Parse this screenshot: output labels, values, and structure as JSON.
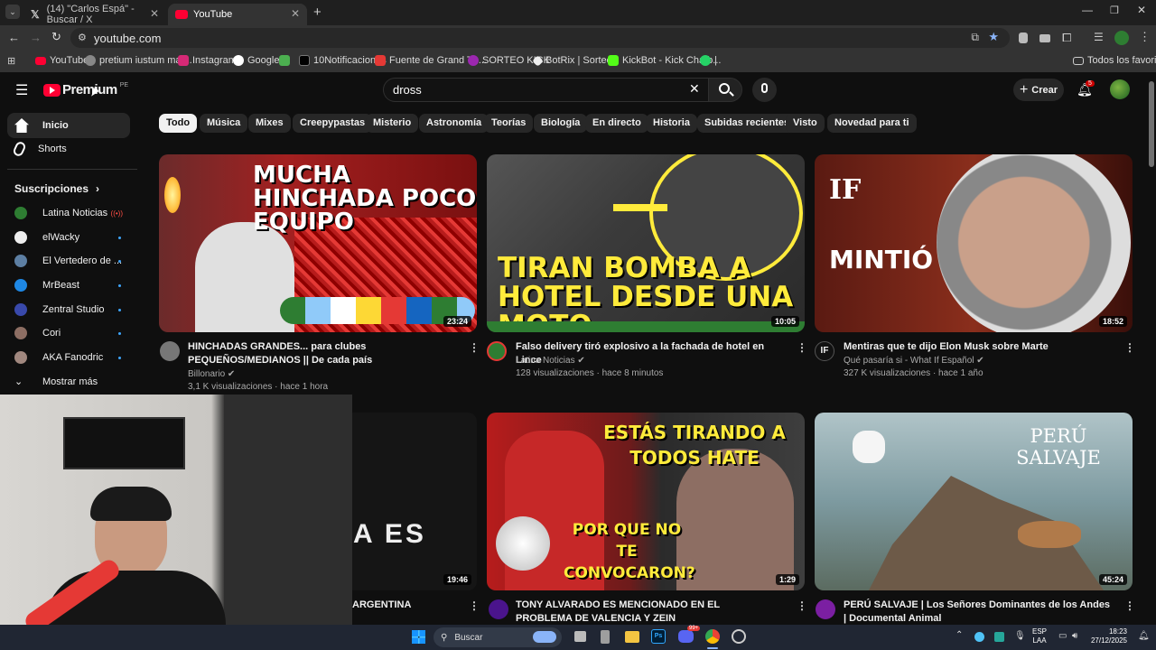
{
  "browser": {
    "tabs": [
      {
        "label": "(14) \"Carlos Espá\" - Buscar / X",
        "icon": "x-logo"
      },
      {
        "label": "YouTube",
        "icon": "youtube-logo"
      }
    ],
    "url": "youtube.com",
    "bookmarks": [
      "YouTube",
      "pretium iustum mat...",
      "Instagram",
      "Google",
      "10Notificaciones",
      "Fuente de Grand Th...",
      "SORTEO KICK",
      "BotRix | Sorteos",
      "KickBot - Kick Chatb...",
      "|"
    ],
    "all_bookmarks": "Todos los favoritos"
  },
  "youtube": {
    "logo_text": "Premium",
    "region": "PE",
    "search_value": "dross",
    "create_label": "Crear",
    "notification_count": "5",
    "chips": [
      "Todo",
      "Música",
      "Mixes",
      "Creepypastas",
      "Misterio",
      "Astronomía",
      "Teorías",
      "Biología",
      "En directo",
      "Historia",
      "Subidas recientes",
      "Visto",
      "Novedad para ti"
    ],
    "sidebar": {
      "home": "Inicio",
      "shorts": "Shorts",
      "subs_header": "Suscripciones",
      "subscriptions": [
        "Latina Noticias",
        "elWacky",
        "El Vertedero de ...",
        "MrBeast",
        "Zentral Studio",
        "Cori",
        "AKA Fanodric"
      ],
      "show_more": "Mostrar más"
    },
    "videos": [
      {
        "thumb_text": "MUCHA HINCHADA POCO EQUIPO",
        "duration": "23:24",
        "title": "HINCHADAS GRANDES... para clubes PEQUEÑOS/MEDIANOS || De cada país",
        "channel": "Billonario",
        "stats": "3,1 K visualizaciones · hace 1 hora"
      },
      {
        "thumb_text": "TIRAN BOMBA A HOTEL DESDE UNA MOTO",
        "duration": "10:05",
        "title": "Falso delivery tiró explosivo a la fachada de hotel en Lince",
        "channel": "Latina Noticias",
        "stats": "128 visualizaciones · hace 8 minutos"
      },
      {
        "thumb_text": "MINTIÓ",
        "thumb_logo": "IF",
        "duration": "18:52",
        "title": "Mentiras que te dijo Elon Musk sobre Marte",
        "channel": "Qué pasaría si - What If Español",
        "stats": "327 K visualizaciones · hace 1 año"
      },
      {
        "thumb_text": "A ES",
        "duration": "19:46",
        "title": "ARGENTINA"
      },
      {
        "thumb_text": "ESTÁS TIRANDO A TODOS HATE",
        "thumb_text2": "POR QUE NO TE CONVOCARON?",
        "duration": "1:29",
        "title": "TONY ALVARADO ES MENCIONADO EN EL PROBLEMA DE VALENCIA Y ZEIN"
      },
      {
        "thumb_text": "PERÚ SALVAJE",
        "duration": "45:24",
        "title": "PERÚ SALVAJE | Los Señores Dominantes de los Andes | Documental Animal"
      }
    ]
  },
  "taskbar": {
    "search_label": "Buscar",
    "lang": "ESP",
    "lang2": "LAA",
    "time": "18:23",
    "date": "27/12/2025",
    "badge": "99+"
  },
  "colors": {
    "yt_red": "#ff0033",
    "accent_blue": "#3ea6ff",
    "bg": "#0f0f0f"
  }
}
